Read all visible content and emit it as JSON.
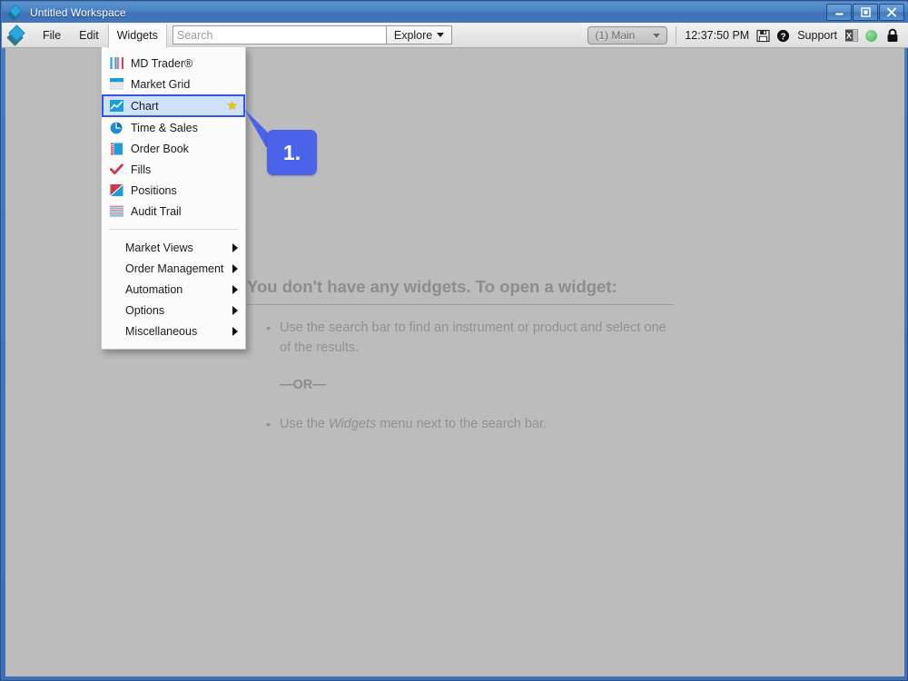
{
  "window": {
    "title": "Untitled Workspace",
    "logo_icon": "tt-diamond-logo",
    "buttons": {
      "minimize": "minimize-icon",
      "maximize": "maximize-icon",
      "close": "close-icon"
    }
  },
  "toolbar": {
    "menus": [
      {
        "label": "File",
        "open": false
      },
      {
        "label": "Edit",
        "open": false
      },
      {
        "label": "Widgets",
        "open": true
      }
    ],
    "search": {
      "placeholder": "Search",
      "value": ""
    },
    "explore_label": "Explore",
    "workspace_selector": "(1) Main",
    "clock": "12:37:50 PM",
    "save_icon": "floppy-save-icon",
    "help_icon": "help-circle-icon",
    "support_label": "Support",
    "excel_icon": "excel-export-icon",
    "status_icon": "green-status-dot",
    "lock_icon": "padlock-icon"
  },
  "widgets_menu": {
    "items": [
      {
        "label": "MD Trader®",
        "icon": "md-trader-icon",
        "selected": false,
        "starred": false
      },
      {
        "label": "Market Grid",
        "icon": "market-grid-icon",
        "selected": false,
        "starred": false
      },
      {
        "label": "Chart",
        "icon": "chart-icon",
        "selected": true,
        "starred": true
      },
      {
        "label": "Time & Sales",
        "icon": "clock-pie-icon",
        "selected": false,
        "starred": false
      },
      {
        "label": "Order Book",
        "icon": "order-book-icon",
        "selected": false,
        "starred": false
      },
      {
        "label": "Fills",
        "icon": "checkmark-icon",
        "selected": false,
        "starred": false
      },
      {
        "label": "Positions",
        "icon": "positions-icon",
        "selected": false,
        "starred": false
      },
      {
        "label": "Audit Trail",
        "icon": "audit-trail-icon",
        "selected": false,
        "starred": false
      }
    ],
    "submenus": [
      {
        "label": "Market Views"
      },
      {
        "label": "Order Management"
      },
      {
        "label": "Automation"
      },
      {
        "label": "Options"
      },
      {
        "label": "Miscellaneous"
      }
    ],
    "star_glyph": "★"
  },
  "callouts": [
    {
      "number": "1."
    }
  ],
  "empty_state": {
    "title": "You don't have any widgets. To open a widget:",
    "bullet_1": "Use the search bar to find an instrument or product and select one of the results.",
    "or_text": "—OR—",
    "bullet_2_prefix": "Use the ",
    "bullet_2_emphasis": "Widgets",
    "bullet_2_suffix": " menu next to the search bar."
  },
  "colors": {
    "accent_blue": "#4a63e8",
    "selection_blue": "#3355ee",
    "selection_fill": "#cfe2fb",
    "canvas_gray": "#bcbcbc",
    "titlebar_blue": "#4a80c2",
    "star_yellow": "#f2c200",
    "status_green": "#59bf6e"
  }
}
